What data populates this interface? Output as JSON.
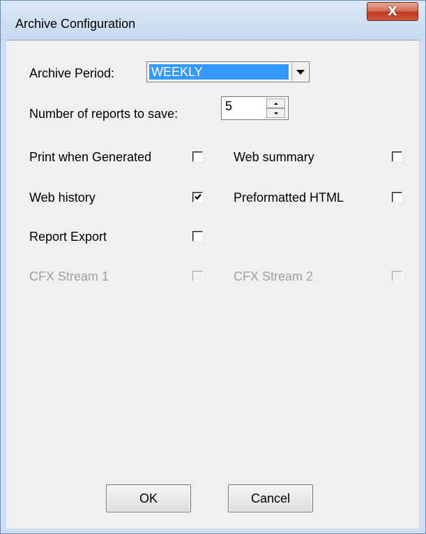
{
  "window": {
    "title": "Archive Configuration",
    "close_label": "X"
  },
  "archive_period": {
    "label": "Archive Period:",
    "value": "WEEKLY"
  },
  "reports_to_save": {
    "label": "Number of reports to save:",
    "value": "5"
  },
  "options": {
    "print_when_generated": {
      "label": "Print when Generated",
      "checked": false,
      "enabled": true
    },
    "web_summary": {
      "label": "Web summary",
      "checked": false,
      "enabled": true
    },
    "web_history": {
      "label": "Web history",
      "checked": true,
      "enabled": true
    },
    "preformatted_html": {
      "label": "Preformatted HTML",
      "checked": false,
      "enabled": true
    },
    "report_export": {
      "label": "Report Export",
      "checked": false,
      "enabled": true
    },
    "cfx_stream_1": {
      "label": "CFX Stream 1",
      "checked": false,
      "enabled": false
    },
    "cfx_stream_2": {
      "label": "CFX Stream 2",
      "checked": false,
      "enabled": false
    }
  },
  "buttons": {
    "ok": "OK",
    "cancel": "Cancel"
  },
  "colors": {
    "selection": "#3399ff",
    "disabled_text": "#a0a0a0",
    "close_button": "#c0391f"
  }
}
